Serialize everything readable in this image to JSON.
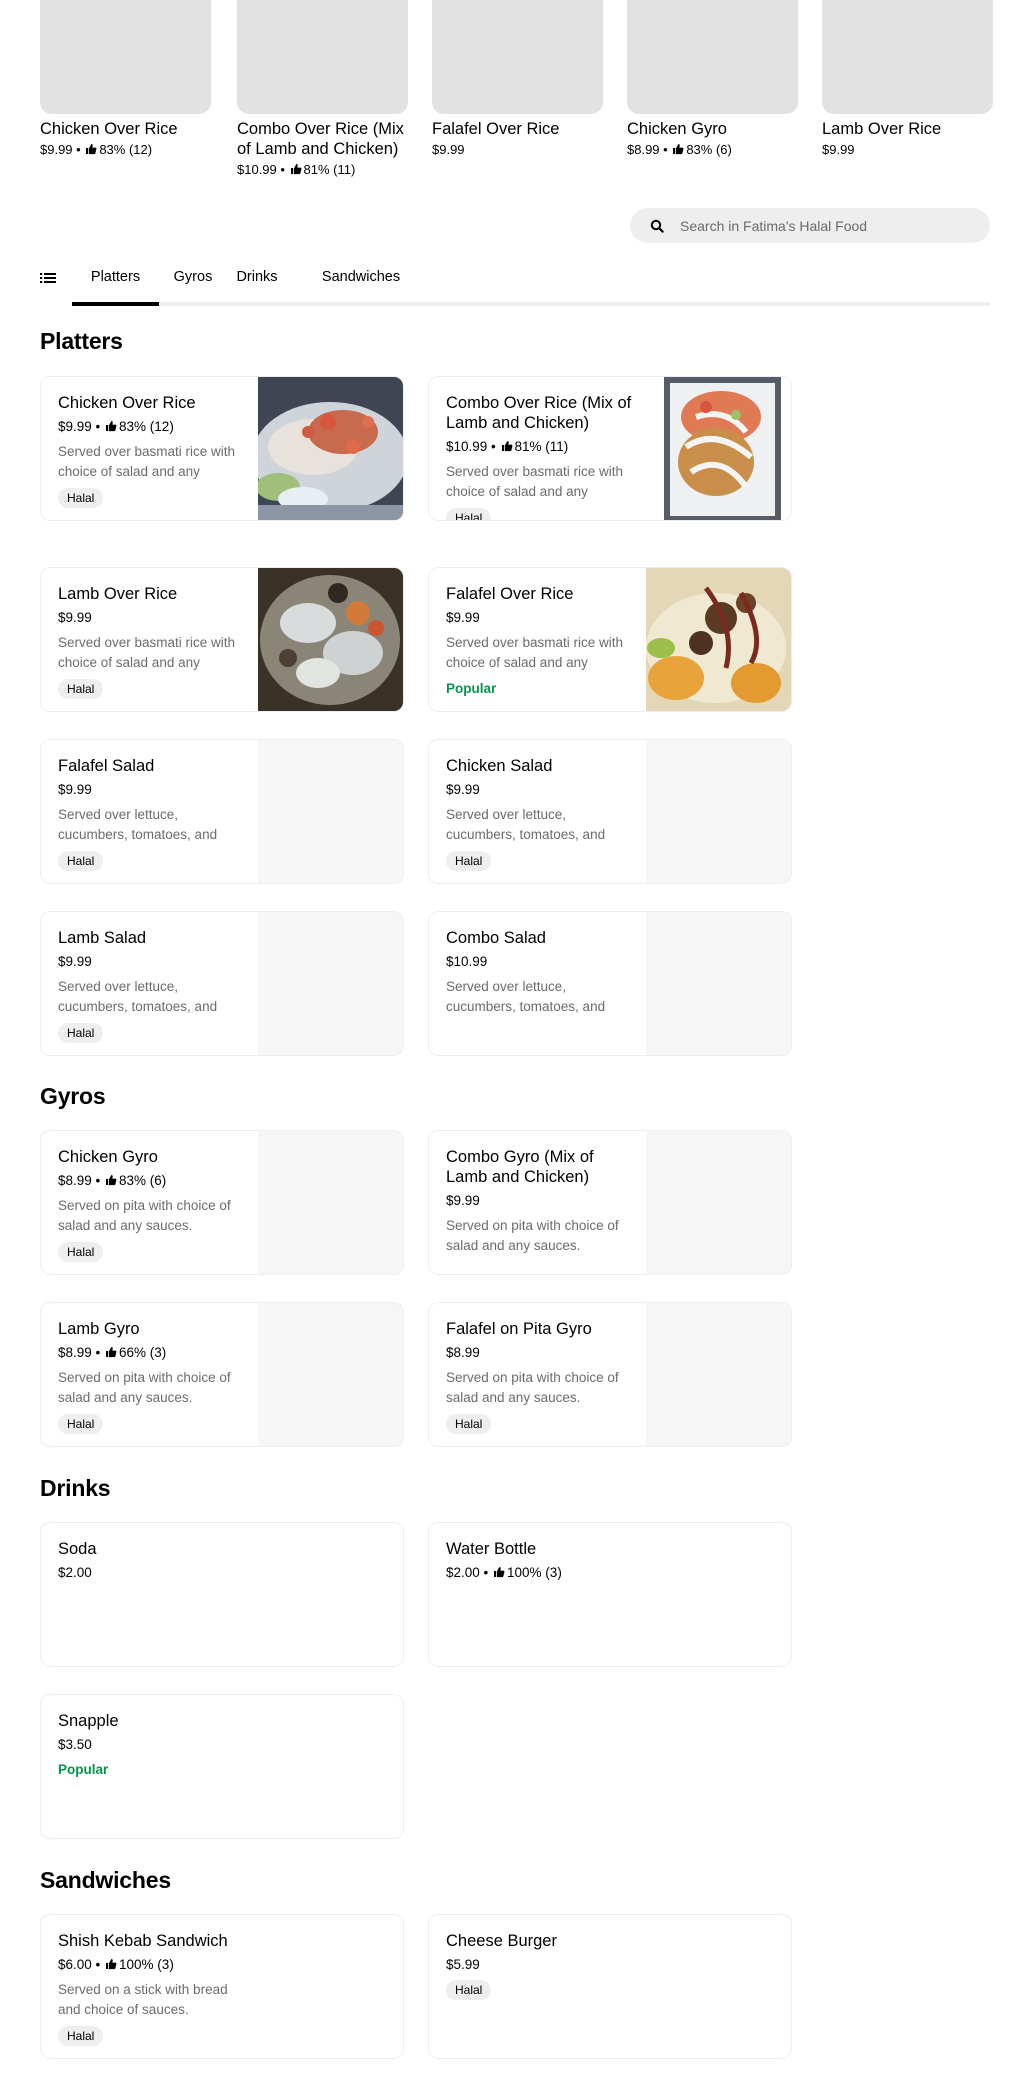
{
  "featured": [
    {
      "title": "Chicken Over Rice",
      "price": "$9.99",
      "rating": "83% (12)"
    },
    {
      "title": "Combo Over Rice (Mix of Lamb and Chicken)",
      "price": "$10.99",
      "rating": "81% (11)"
    },
    {
      "title": "Falafel Over Rice",
      "price": "$9.99",
      "rating": ""
    },
    {
      "title": "Chicken Gyro",
      "price": "$8.99",
      "rating": "83% (6)"
    },
    {
      "title": "Lamb Over Rice",
      "price": "$9.99",
      "rating": ""
    }
  ],
  "search": {
    "placeholder": "Search in Fatima's Halal Food",
    "icon": "search-icon"
  },
  "tabs": [
    {
      "label": "Platters",
      "active": true
    },
    {
      "label": "Gyros",
      "active": false
    },
    {
      "label": "Drinks",
      "active": false
    },
    {
      "label": "Sandwiches",
      "active": false
    }
  ],
  "colors": {
    "popular": "#05944f",
    "badge_bg": "#eeeeee",
    "muted_text": "#6b6b6b"
  },
  "sections": [
    {
      "title": "Platters",
      "items": [
        {
          "title": "Chicken Over Rice",
          "price": "$9.99",
          "rating": "83% (12)",
          "description": "Served over basmati rice with choice of salad and any sauces.",
          "badge": "Halal",
          "popular": "",
          "image": "chicken-over-rice-photo"
        },
        {
          "title": "Combo Over Rice (Mix of Lamb and Chicken)",
          "price": "$10.99",
          "rating": "81% (11)",
          "description": "Served over basmati rice with choice of salad and any sauces.",
          "badge": "Halal",
          "popular": "",
          "image": "combo-over-rice-photo"
        },
        {
          "title": "Lamb Over Rice",
          "price": "$9.99",
          "rating": "",
          "description": "Served over basmati rice with choice of salad and any sauces.",
          "badge": "Halal",
          "popular": "",
          "image": "lamb-over-rice-photo"
        },
        {
          "title": "Falafel Over Rice",
          "price": "$9.99",
          "rating": "",
          "description": "Served over basmati rice with choice of salad and any sauces.",
          "badge": "",
          "popular": "Popular",
          "image": "falafel-over-rice-photo"
        },
        {
          "title": "Falafel Salad",
          "price": "$9.99",
          "rating": "",
          "description": "Served over lettuce, cucumbers, tomatoes, and onions.",
          "badge": "Halal",
          "popular": "",
          "image": ""
        },
        {
          "title": "Chicken Salad",
          "price": "$9.99",
          "rating": "",
          "description": "Served over lettuce, cucumbers, tomatoes, and onions.",
          "badge": "Halal",
          "popular": "",
          "image": ""
        },
        {
          "title": "Lamb Salad",
          "price": "$9.99",
          "rating": "",
          "description": "Served over lettuce, cucumbers, tomatoes, and onions.",
          "badge": "Halal",
          "popular": "",
          "image": ""
        },
        {
          "title": "Combo Salad",
          "price": "$10.99",
          "rating": "",
          "description": "Served over lettuce, cucumbers, tomatoes, and onions.",
          "badge": "",
          "popular": "",
          "image": ""
        }
      ]
    },
    {
      "title": "Gyros",
      "items": [
        {
          "title": "Chicken Gyro",
          "price": "$8.99",
          "rating": "83% (6)",
          "description": "Served on pita with choice of salad and any sauces.",
          "badge": "Halal",
          "popular": "",
          "image": ""
        },
        {
          "title": "Combo Gyro (Mix of Lamb and Chicken)",
          "price": "$9.99",
          "rating": "",
          "description": "Served on pita with choice of salad and any sauces.",
          "badge": "",
          "popular": "",
          "image": ""
        },
        {
          "title": "Lamb Gyro",
          "price": "$8.99",
          "rating": "66% (3)",
          "description": "Served on pita with choice of salad and any sauces.",
          "badge": "Halal",
          "popular": "",
          "image": ""
        },
        {
          "title": "Falafel on Pita Gyro",
          "price": "$8.99",
          "rating": "",
          "description": "Served on pita with choice of salad and any sauces.",
          "badge": "Halal",
          "popular": "",
          "image": ""
        }
      ]
    },
    {
      "title": "Drinks",
      "items": [
        {
          "title": "Soda",
          "price": "$2.00",
          "rating": "",
          "description": "",
          "badge": "",
          "popular": "",
          "image": "none"
        },
        {
          "title": "Water Bottle",
          "price": "$2.00",
          "rating": "100% (3)",
          "description": "",
          "badge": "",
          "popular": "",
          "image": "none"
        },
        {
          "title": "Snapple",
          "price": "$3.50",
          "rating": "",
          "description": "",
          "badge": "",
          "popular": "Popular",
          "image": "none"
        }
      ]
    },
    {
      "title": "Sandwiches",
      "items": [
        {
          "title": "Shish Kebab Sandwich",
          "price": "$6.00",
          "rating": "100% (3)",
          "description": "Served on a stick with bread and choice of sauces.",
          "badge": "Halal",
          "popular": "",
          "image": "none"
        },
        {
          "title": "Cheese Burger",
          "price": "$5.99",
          "rating": "",
          "description": "",
          "badge": "Halal",
          "popular": "",
          "image": "none"
        }
      ]
    }
  ]
}
